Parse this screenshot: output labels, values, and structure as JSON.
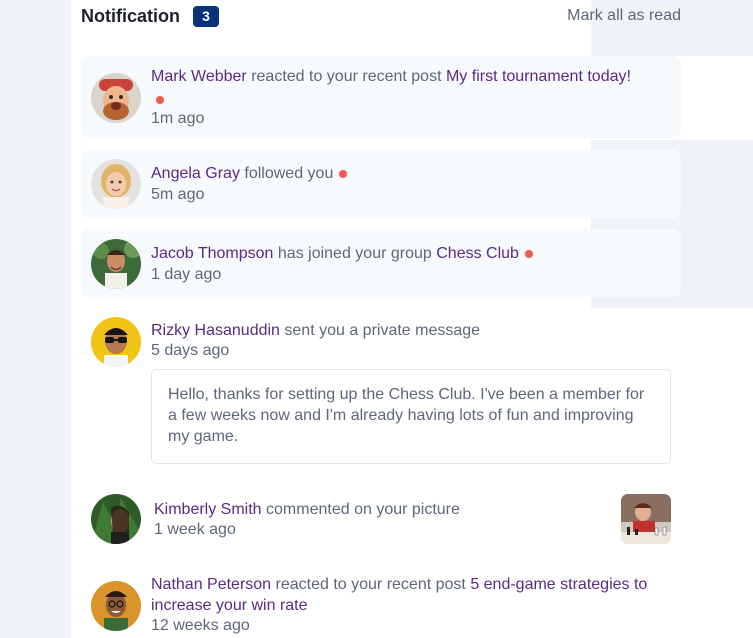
{
  "header": {
    "title": "Notification",
    "unread_count": "3",
    "mark_all_label": "Mark all as read"
  },
  "notifications": [
    {
      "name": "Mark Webber",
      "action": "reacted to your recent post",
      "target": "My first tournament today!",
      "time": "1m ago",
      "unread": true,
      "avatar_icon": "avatar-mark-webber"
    },
    {
      "name": "Angela Gray",
      "action": "followed you",
      "target": "",
      "time": "5m ago",
      "unread": true,
      "avatar_icon": "avatar-angela-gray"
    },
    {
      "name": "Jacob Thompson",
      "action": "has joined your group",
      "target": "Chess Club",
      "time": "1 day ago",
      "unread": true,
      "avatar_icon": "avatar-jacob-thompson"
    },
    {
      "name": "Rizky Hasanuddin",
      "action": "sent you a private message",
      "target": "",
      "time": "5 days ago",
      "unread": false,
      "message": "Hello, thanks for setting up the Chess Club. I've been a member for a few weeks now and I'm already having lots of fun and improving my game.",
      "avatar_icon": "avatar-rizky-hasanuddin"
    },
    {
      "name": "Kimberly Smith",
      "action": "commented on your picture",
      "target": "",
      "time": "1 week ago",
      "unread": false,
      "picture_icon": "chess-picture-thumbnail",
      "avatar_icon": "avatar-kimberly-smith"
    },
    {
      "name": "Nathan Peterson",
      "action": "reacted to your recent post",
      "target": "5 end-game strategies to increase your win rate",
      "time": "12 weeks ago",
      "unread": false,
      "avatar_icon": "avatar-nathan-peterson"
    }
  ],
  "colors": {
    "unread_bg": "#f7fafd",
    "badge": "#0a327b",
    "dot": "#f65552",
    "name": "#5a2a82",
    "text": "#5e6778"
  }
}
